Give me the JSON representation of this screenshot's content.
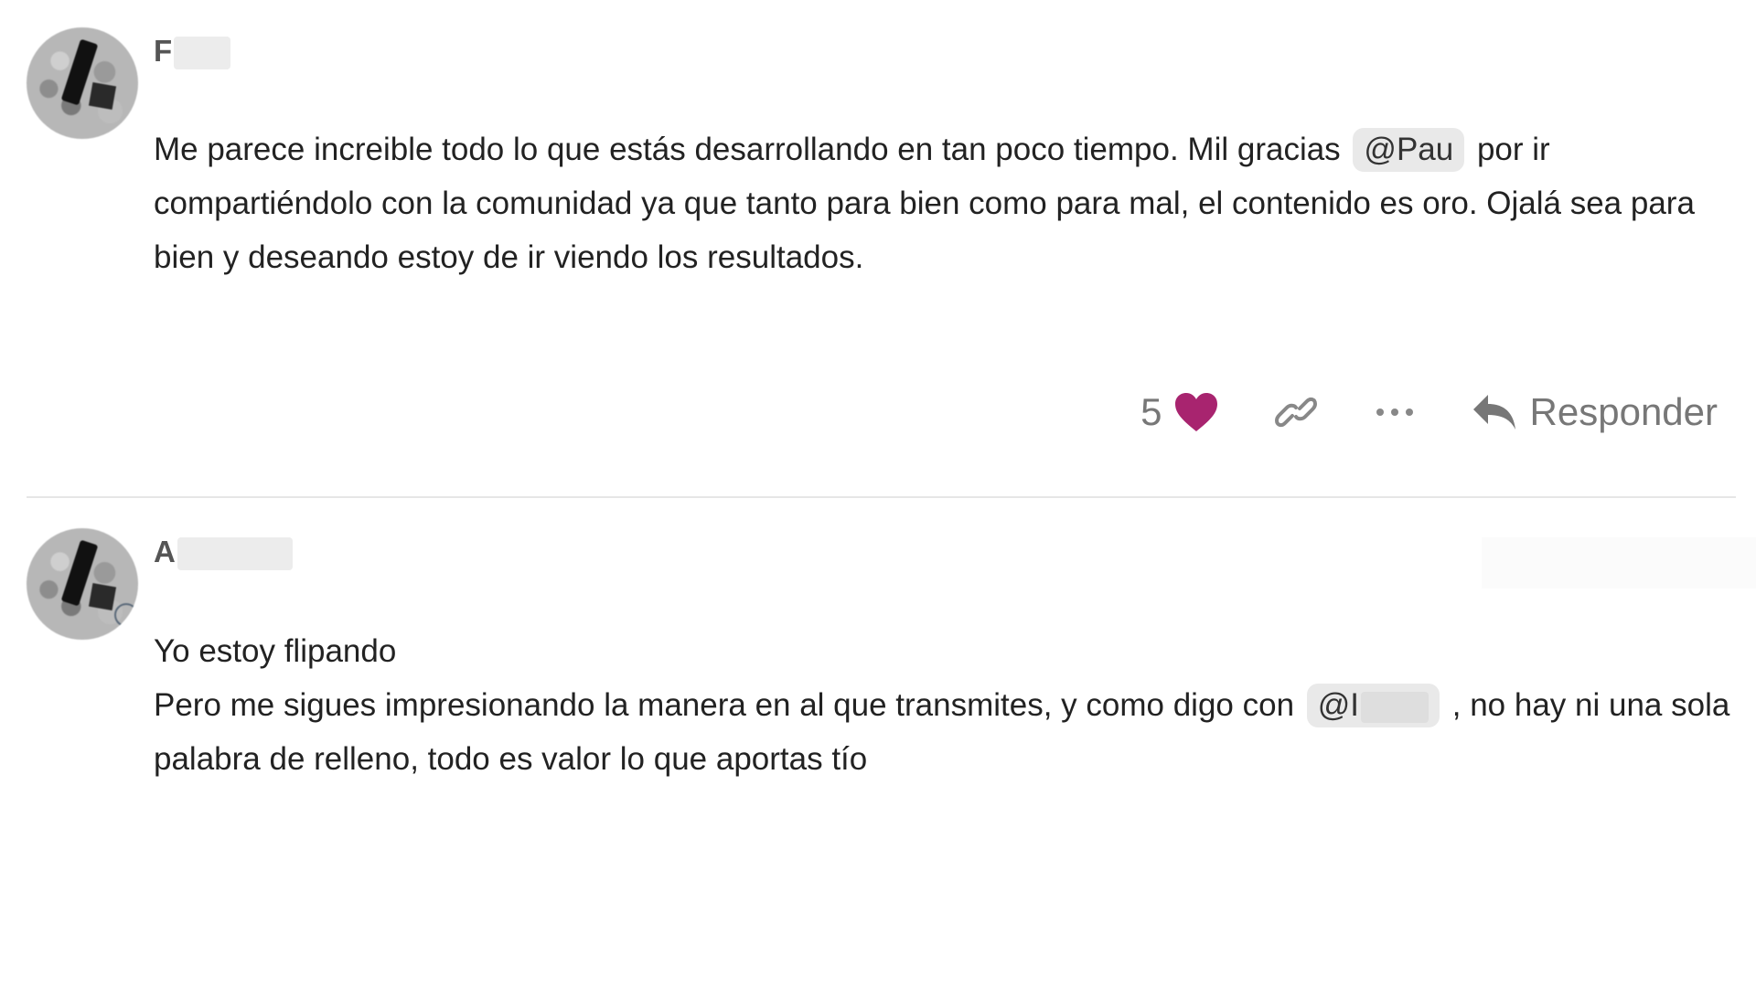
{
  "posts": [
    {
      "username_visible": "F",
      "paragraphs": {
        "p1_a": "Me parece increible todo lo que estás desarrollando en tan poco tiempo. Mil gracias ",
        "p1_mention": "@Pau",
        "p1_b": " por ir compartiéndolo con la comunidad ya que tanto para bien como para mal, el contenido es oro. Ojalá sea para bien y deseando estoy de ir viendo los resultados."
      },
      "actions": {
        "like_count": "5",
        "reply_label": "Responder",
        "heart_color": "#a8246f"
      },
      "icons": {
        "heart": "heart-icon",
        "link": "link-icon",
        "more": "more-horizontal-icon",
        "reply": "reply-arrow-icon"
      }
    },
    {
      "username_visible": "A",
      "paragraphs": {
        "line1": "Yo estoy flipando",
        "line2_a": "Pero me sigues impresionando la manera en al que transmites, y como digo con ",
        "line2_mention": "@I",
        "line2_b": " , no hay ni una sola palabra de relleno, todo es valor lo que aportas tío"
      }
    }
  ]
}
